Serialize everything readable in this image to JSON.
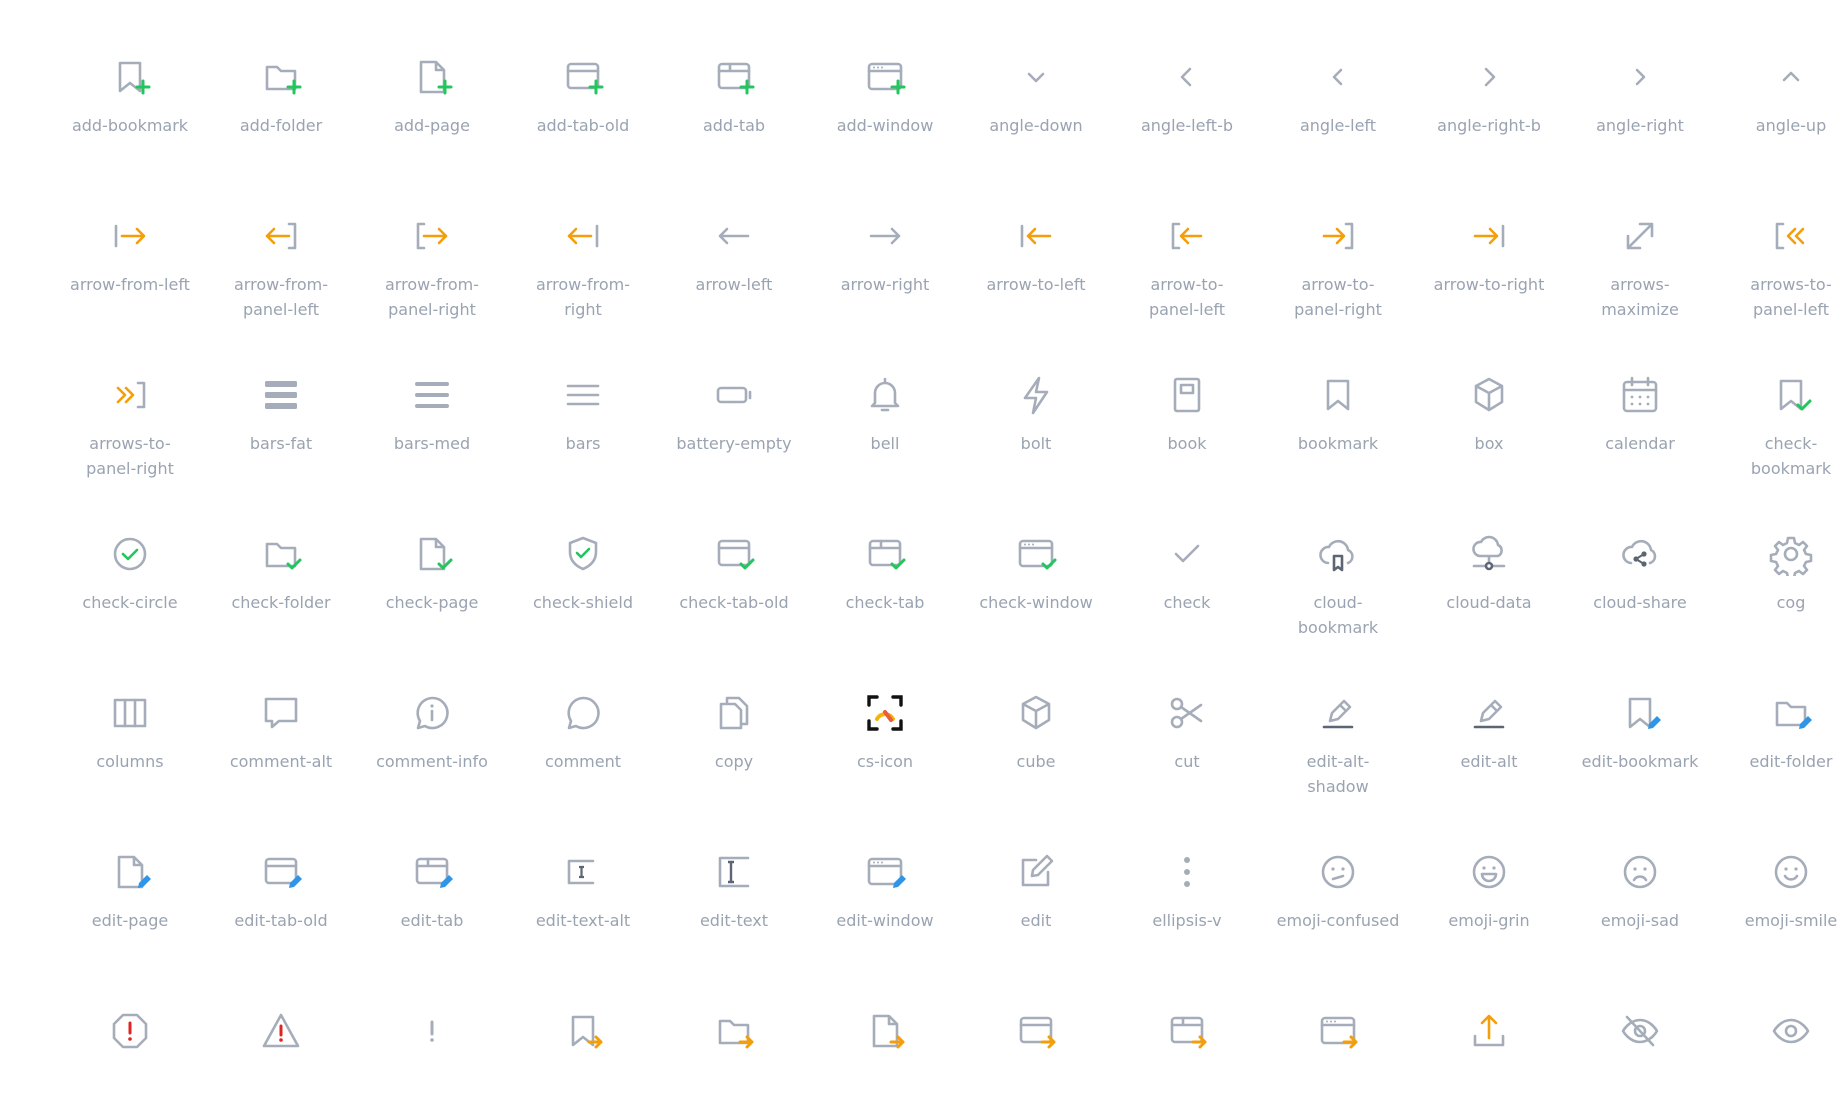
{
  "colors": {
    "icon_gray": "#a6adba",
    "icon_dark": "#5b6573",
    "label_gray": "#9aa3b1",
    "accent_green": "#22c55e",
    "accent_orange": "#f59e0b",
    "accent_blue": "#2f95e8",
    "accent_red": "#e02424"
  },
  "icons": [
    {
      "name": "add-bookmark",
      "label": "add-bookmark",
      "glyph": "bookmark",
      "badge": "plus"
    },
    {
      "name": "add-folder",
      "label": "add-folder",
      "glyph": "folder",
      "badge": "plus"
    },
    {
      "name": "add-page",
      "label": "add-page",
      "glyph": "page",
      "badge": "plus"
    },
    {
      "name": "add-tab-old",
      "label": "add-tab-old",
      "glyph": "tabold",
      "badge": "plus"
    },
    {
      "name": "add-tab",
      "label": "add-tab",
      "glyph": "tab",
      "badge": "plus"
    },
    {
      "name": "add-window",
      "label": "add-window",
      "glyph": "window",
      "badge": "plus"
    },
    {
      "name": "angle-down",
      "label": "angle-down",
      "glyph": "angle-down"
    },
    {
      "name": "angle-left-b",
      "label": "angle-left-b",
      "glyph": "angle-left-b"
    },
    {
      "name": "angle-left",
      "label": "angle-left",
      "glyph": "angle-left"
    },
    {
      "name": "angle-right-b",
      "label": "angle-right-b",
      "glyph": "angle-right-b"
    },
    {
      "name": "angle-right",
      "label": "angle-right",
      "glyph": "angle-right"
    },
    {
      "name": "angle-up",
      "label": "angle-up",
      "glyph": "angle-up"
    },
    {
      "name": "arrow-from-left",
      "label": "arrow-from-left",
      "glyph": "arrow-from-left"
    },
    {
      "name": "arrow-from-panel-left",
      "label": "arrow-from-\npanel-left",
      "glyph": "arrow-from-panel-left"
    },
    {
      "name": "arrow-from-panel-right",
      "label": "arrow-from-\npanel-right",
      "glyph": "arrow-from-panel-right"
    },
    {
      "name": "arrow-from-right",
      "label": "arrow-from-\nright",
      "glyph": "arrow-from-right"
    },
    {
      "name": "arrow-left",
      "label": "arrow-left",
      "glyph": "arrow-left"
    },
    {
      "name": "arrow-right",
      "label": "arrow-right",
      "glyph": "arrow-right"
    },
    {
      "name": "arrow-to-left",
      "label": "arrow-to-left",
      "glyph": "arrow-to-left"
    },
    {
      "name": "arrow-to-panel-left",
      "label": "arrow-to-\npanel-left",
      "glyph": "arrow-to-panel-left"
    },
    {
      "name": "arrow-to-panel-right",
      "label": "arrow-to-\npanel-right",
      "glyph": "arrow-to-panel-right"
    },
    {
      "name": "arrow-to-right",
      "label": "arrow-to-right",
      "glyph": "arrow-to-right"
    },
    {
      "name": "arrows-maximize",
      "label": "arrows-\nmaximize",
      "glyph": "arrows-maximize"
    },
    {
      "name": "arrows-to-panel-left",
      "label": "arrows-to-\npanel-left",
      "glyph": "arrows-to-panel-left"
    },
    {
      "name": "arrows-to-panel-right",
      "label": "arrows-to-\npanel-right",
      "glyph": "arrows-to-panel-right"
    },
    {
      "name": "bars-fat",
      "label": "bars-fat",
      "glyph": "bars-fat"
    },
    {
      "name": "bars-med",
      "label": "bars-med",
      "glyph": "bars-med"
    },
    {
      "name": "bars",
      "label": "bars",
      "glyph": "bars"
    },
    {
      "name": "battery-empty",
      "label": "battery-empty",
      "glyph": "battery"
    },
    {
      "name": "bell",
      "label": "bell",
      "glyph": "bell"
    },
    {
      "name": "bolt",
      "label": "bolt",
      "glyph": "bolt"
    },
    {
      "name": "book",
      "label": "book",
      "glyph": "book"
    },
    {
      "name": "bookmark",
      "label": "bookmark",
      "glyph": "bookmark"
    },
    {
      "name": "box",
      "label": "box",
      "glyph": "box"
    },
    {
      "name": "calendar",
      "label": "calendar",
      "glyph": "calendar"
    },
    {
      "name": "check-bookmark",
      "label": "check-\nbookmark",
      "glyph": "bookmark",
      "badge": "check"
    },
    {
      "name": "check-circle",
      "label": "check-circle",
      "glyph": "check-circle"
    },
    {
      "name": "check-folder",
      "label": "check-folder",
      "glyph": "folder",
      "badge": "check"
    },
    {
      "name": "check-page",
      "label": "check-page",
      "glyph": "page",
      "badge": "check"
    },
    {
      "name": "check-shield",
      "label": "check-shield",
      "glyph": "shield"
    },
    {
      "name": "check-tab-old",
      "label": "check-tab-old",
      "glyph": "tabold",
      "badge": "check"
    },
    {
      "name": "check-tab",
      "label": "check-tab",
      "glyph": "tab",
      "badge": "check"
    },
    {
      "name": "check-window",
      "label": "check-window",
      "glyph": "window",
      "badge": "check"
    },
    {
      "name": "check",
      "label": "check",
      "glyph": "check"
    },
    {
      "name": "cloud-bookmark",
      "label": "cloud-\nbookmark",
      "glyph": "cloud-bookmark"
    },
    {
      "name": "cloud-data",
      "label": "cloud-data",
      "glyph": "cloud-data"
    },
    {
      "name": "cloud-share",
      "label": "cloud-share",
      "glyph": "cloud-share"
    },
    {
      "name": "cog",
      "label": "cog",
      "glyph": "cog"
    },
    {
      "name": "columns",
      "label": "columns",
      "glyph": "columns"
    },
    {
      "name": "comment-alt",
      "label": "comment-alt",
      "glyph": "comment-alt"
    },
    {
      "name": "comment-info",
      "label": "comment-info",
      "glyph": "comment-info"
    },
    {
      "name": "comment",
      "label": "comment",
      "glyph": "comment"
    },
    {
      "name": "copy",
      "label": "copy",
      "glyph": "copy"
    },
    {
      "name": "cs-icon",
      "label": "cs-icon",
      "glyph": "cs-icon"
    },
    {
      "name": "cube",
      "label": "cube",
      "glyph": "box"
    },
    {
      "name": "cut",
      "label": "cut",
      "glyph": "cut"
    },
    {
      "name": "edit-alt-shadow",
      "label": "edit-alt-\nshadow",
      "glyph": "edit-alt-shadow"
    },
    {
      "name": "edit-alt",
      "label": "edit-alt",
      "glyph": "edit-alt"
    },
    {
      "name": "edit-bookmark",
      "label": "edit-bookmark",
      "glyph": "bookmark",
      "badge": "pencil"
    },
    {
      "name": "edit-folder",
      "label": "edit-folder",
      "glyph": "folder",
      "badge": "pencil"
    },
    {
      "name": "edit-page",
      "label": "edit-page",
      "glyph": "page",
      "badge": "pencil"
    },
    {
      "name": "edit-tab-old",
      "label": "edit-tab-old",
      "glyph": "tabold",
      "badge": "pencil"
    },
    {
      "name": "edit-tab",
      "label": "edit-tab",
      "glyph": "tab",
      "badge": "pencil"
    },
    {
      "name": "edit-text-alt",
      "label": "edit-text-alt",
      "glyph": "edit-text-alt"
    },
    {
      "name": "edit-text",
      "label": "edit-text",
      "glyph": "edit-text"
    },
    {
      "name": "edit-window",
      "label": "edit-window",
      "glyph": "window",
      "badge": "pencil"
    },
    {
      "name": "edit",
      "label": "edit",
      "glyph": "edit"
    },
    {
      "name": "ellipsis-v",
      "label": "ellipsis-v",
      "glyph": "ellipsis-v"
    },
    {
      "name": "emoji-confused",
      "label": "emoji-confused",
      "glyph": "emoji-confused"
    },
    {
      "name": "emoji-grin",
      "label": "emoji-grin",
      "glyph": "emoji-grin"
    },
    {
      "name": "emoji-sad",
      "label": "emoji-sad",
      "glyph": "emoji-sad"
    },
    {
      "name": "emoji-smile",
      "label": "emoji-smile",
      "glyph": "emoji-smile"
    },
    {
      "name": "octagon-exclamation",
      "label": "",
      "glyph": "octagon-excl"
    },
    {
      "name": "triangle-exclamation",
      "label": "",
      "glyph": "triangle-excl"
    },
    {
      "name": "exclamation",
      "label": "",
      "glyph": "exclamation"
    },
    {
      "name": "bookmark-export",
      "label": "",
      "glyph": "bookmark",
      "badge": "arrow"
    },
    {
      "name": "folder-export",
      "label": "",
      "glyph": "folder",
      "badge": "arrow"
    },
    {
      "name": "page-export",
      "label": "",
      "glyph": "page",
      "badge": "arrow"
    },
    {
      "name": "tab-old-export",
      "label": "",
      "glyph": "tabold",
      "badge": "arrow"
    },
    {
      "name": "tab-export",
      "label": "",
      "glyph": "tab",
      "badge": "arrow"
    },
    {
      "name": "window-export",
      "label": "",
      "glyph": "window",
      "badge": "arrow"
    },
    {
      "name": "upload",
      "label": "",
      "glyph": "upload"
    },
    {
      "name": "eye-slash",
      "label": "",
      "glyph": "eye-slash"
    },
    {
      "name": "eye",
      "label": "",
      "glyph": "eye"
    }
  ]
}
